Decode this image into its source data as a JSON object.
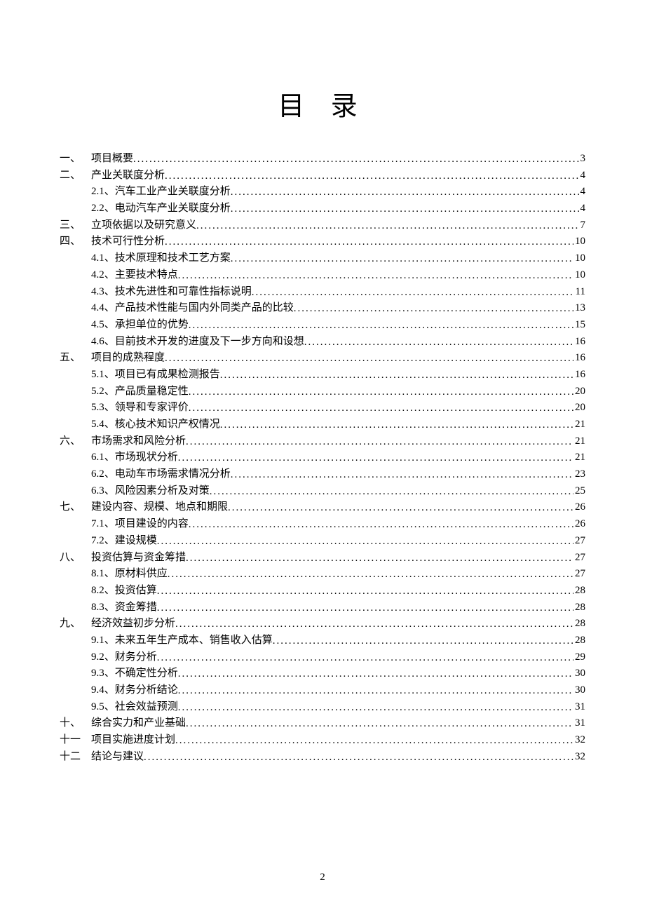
{
  "title": "目 录",
  "page_number": "2",
  "toc": [
    {
      "num": "一、",
      "text": "项目概要",
      "page": "3",
      "level": 1
    },
    {
      "num": "二、",
      "text": "产业关联度分析",
      "page": "4",
      "level": 1
    },
    {
      "num": "",
      "text": "2.1、汽车工业产业关联度分析",
      "page": "4",
      "level": 2
    },
    {
      "num": "",
      "text": "2.2、电动汽车产业关联度分析",
      "page": "4",
      "level": 2
    },
    {
      "num": "三、",
      "text": "立项依据以及研究意义",
      "page": "7",
      "level": 1
    },
    {
      "num": "四、",
      "text": "技术可行性分析",
      "page": "10",
      "level": 1
    },
    {
      "num": "",
      "text": "4.1、技术原理和技术工艺方案 ",
      "page": "10",
      "level": 2
    },
    {
      "num": "",
      "text": "4.2、主要技术特点 ",
      "page": "10",
      "level": 2
    },
    {
      "num": "",
      "text": "4.3、技术先进性和可靠性指标说明 ",
      "page": "11",
      "level": 2
    },
    {
      "num": "",
      "text": "4.4、产品技术性能与国内外同类产品的比较 ",
      "page": "13",
      "level": 2
    },
    {
      "num": "",
      "text": "4.5、承担单位的优势 ",
      "page": "15",
      "level": 2
    },
    {
      "num": "",
      "text": "4.6、目前技术开发的进度及下一步方向和设想 ",
      "page": "16",
      "level": 2
    },
    {
      "num": "五、",
      "text": "项目的成熟程度",
      "page": "16",
      "level": 1
    },
    {
      "num": "",
      "text": "5.1、项目已有成果检测报告 ",
      "page": "16",
      "level": 2
    },
    {
      "num": "",
      "text": "5.2、产品质量稳定性 ",
      "page": "20",
      "level": 2
    },
    {
      "num": "",
      "text": "5.3、领导和专家评价 ",
      "page": "20",
      "level": 2
    },
    {
      "num": "",
      "text": "5.4、核心技术知识产权情况 ",
      "page": "21",
      "level": 2
    },
    {
      "num": "六、",
      "text": "市场需求和风险分析",
      "page": "21",
      "level": 1
    },
    {
      "num": "",
      "text": "6.1、市场现状分析 ",
      "page": "21",
      "level": 2
    },
    {
      "num": "",
      "text": "6.2、电动车市场需求情况分析 ",
      "page": "23",
      "level": 2
    },
    {
      "num": "",
      "text": "6.3、风险因素分析及对策 ",
      "page": "25",
      "level": 2
    },
    {
      "num": "七、",
      "text": "建设内容、规模、地点和期限",
      "page": "26",
      "level": 1
    },
    {
      "num": "",
      "text": "7.1、项目建设的内容 ",
      "page": "26",
      "level": 2
    },
    {
      "num": "",
      "text": "7.2、建设规模 ",
      "page": "27",
      "level": 2
    },
    {
      "num": "八、",
      "text": "投资估算与资金筹措",
      "page": "27",
      "level": 1
    },
    {
      "num": "",
      "text": "8.1、原材料供应 ",
      "page": "27",
      "level": 2
    },
    {
      "num": "",
      "text": "8.2、投资估算 ",
      "page": "28",
      "level": 2
    },
    {
      "num": "",
      "text": "8.3、资金筹措 ",
      "page": "28",
      "level": 2
    },
    {
      "num": "九、",
      "text": "经济效益初步分析",
      "page": "28",
      "level": 1
    },
    {
      "num": "",
      "text": "9.1、未来五年生产成本、销售收入估算 ",
      "page": "28",
      "level": 2
    },
    {
      "num": "",
      "text": "9.2、财务分析 ",
      "page": "29",
      "level": 2
    },
    {
      "num": "",
      "text": "9.3、不确定性分析 ",
      "page": "30",
      "level": 2
    },
    {
      "num": "",
      "text": "9.4、财务分析结论 ",
      "page": "30",
      "level": 2
    },
    {
      "num": "",
      "text": "9.5、社会效益预测 ",
      "page": "31",
      "level": 2
    },
    {
      "num": "十、",
      "text": "综合实力和产业基础",
      "page": "31",
      "level": 1
    },
    {
      "num": "十一",
      "text": "项目实施进度计划",
      "page": "32",
      "level": 1
    },
    {
      "num": "十二",
      "text": "结论与建议",
      "page": "32",
      "level": 1
    }
  ]
}
